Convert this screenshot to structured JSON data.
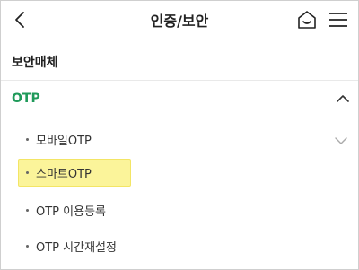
{
  "header": {
    "title": "인증/보안",
    "back_icon": "chevron-left-icon",
    "home_icon": "home-icon",
    "menu_icon": "hamburger-menu-icon"
  },
  "section": {
    "title": "보안매체"
  },
  "group": {
    "label": "OTP",
    "expanded": true,
    "expanded_icon": "chevron-up-icon",
    "color": "#1f9a5a"
  },
  "items": [
    {
      "label": "모바일OTP",
      "highlighted": false,
      "icon": "chevron-down-icon"
    },
    {
      "label": "스마트OTP",
      "highlighted": true
    },
    {
      "label": "OTP 이용등록",
      "highlighted": false
    },
    {
      "label": "OTP 시간재설정",
      "highlighted": false
    }
  ],
  "colors": {
    "highlight": "#fbf49a",
    "text": "#333333"
  }
}
